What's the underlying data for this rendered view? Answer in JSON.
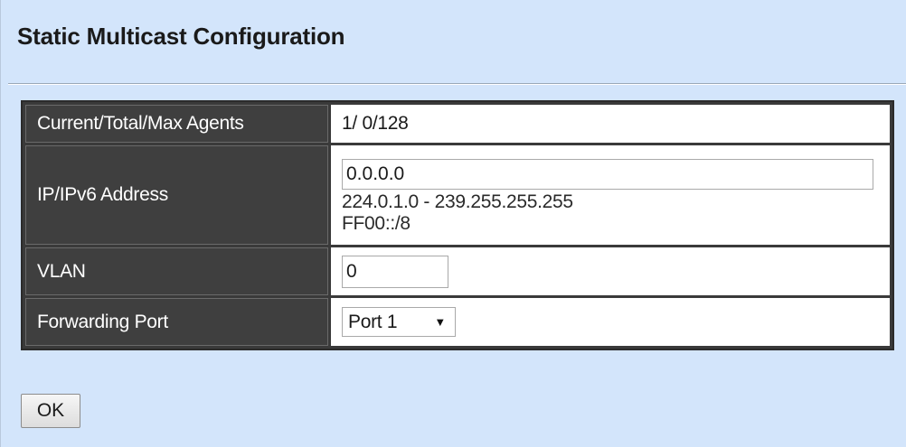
{
  "page": {
    "title": "Static Multicast Configuration"
  },
  "form": {
    "agents": {
      "label": "Current/Total/Max Agents",
      "value": "1/ 0/128"
    },
    "ip": {
      "label": "IP/IPv6 Address",
      "value": "0.0.0.0",
      "hint_ipv4": "224.0.1.0 - 239.255.255.255",
      "hint_ipv6": "FF00::/8"
    },
    "vlan": {
      "label": "VLAN",
      "value": "0"
    },
    "forwarding_port": {
      "label": "Forwarding Port",
      "selected": "Port 1",
      "arrow": "▼"
    }
  },
  "actions": {
    "ok_label": "OK"
  }
}
